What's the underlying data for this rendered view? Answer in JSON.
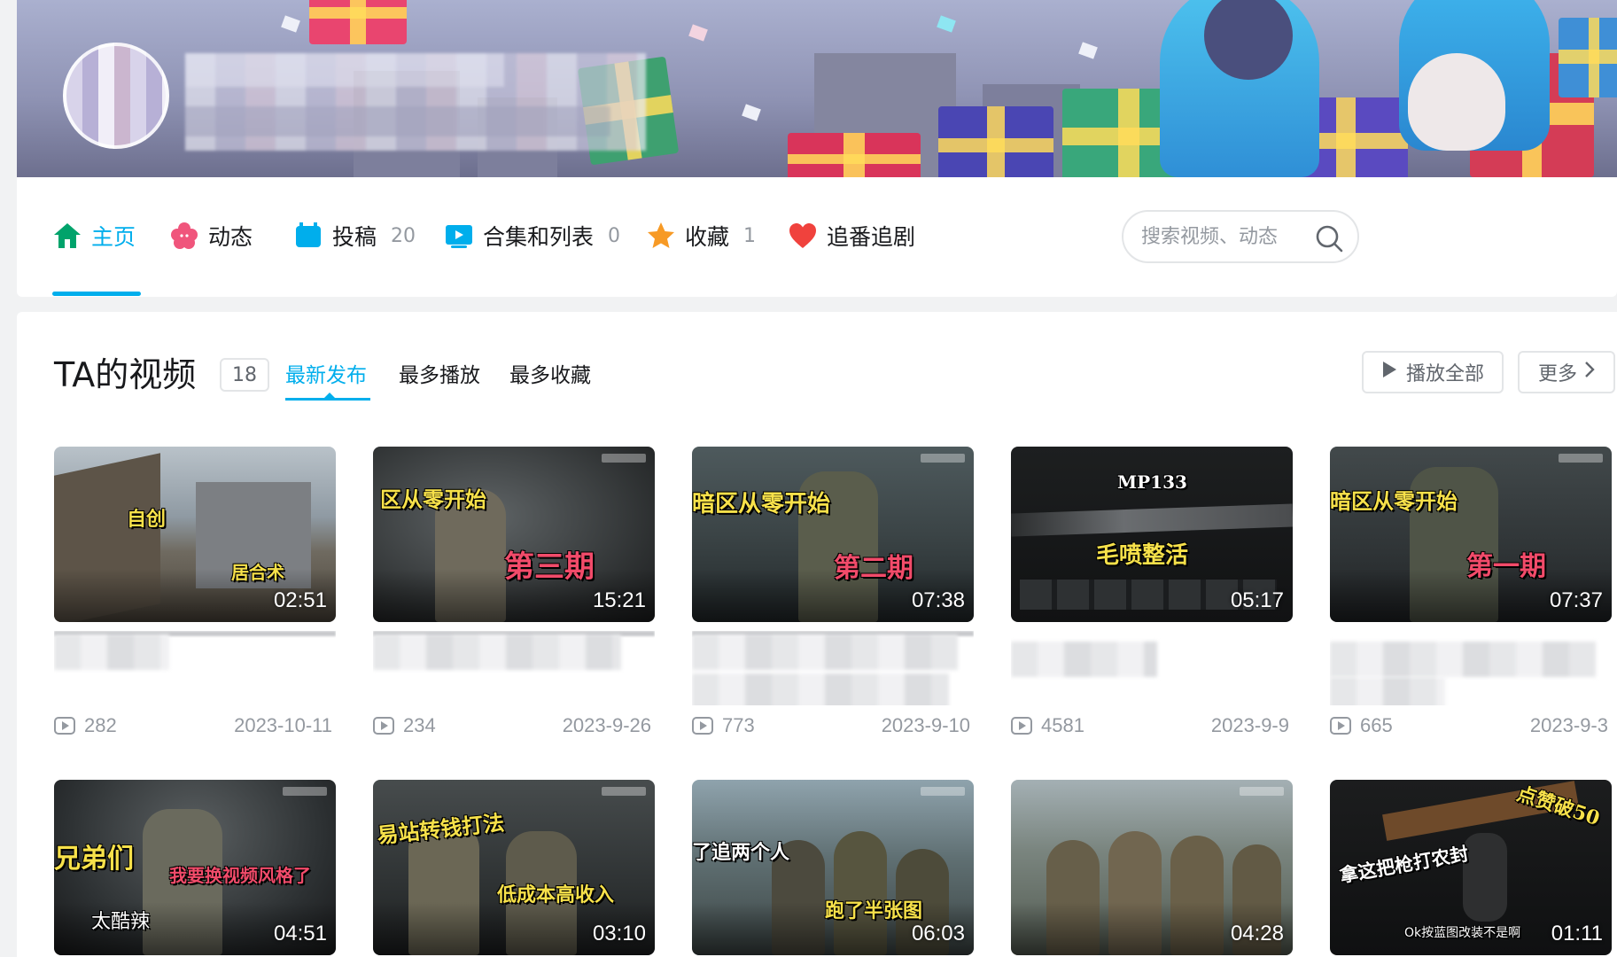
{
  "nav": {
    "tabs": [
      {
        "label": "主页",
        "count": "",
        "icon": "home-icon",
        "color": "#00a36b",
        "active": true
      },
      {
        "label": "动态",
        "count": "",
        "icon": "flower-icon",
        "color": "#f0557c"
      },
      {
        "label": "投稿",
        "count": "20",
        "icon": "video-upload-icon",
        "color": "#00aeec"
      },
      {
        "label": "合集和列表",
        "count": "0",
        "icon": "collection-icon",
        "color": "#00aeec"
      },
      {
        "label": "收藏",
        "count": "1",
        "icon": "star-icon",
        "color": "#f79a25"
      },
      {
        "label": "追番追剧",
        "count": "",
        "icon": "heart-icon",
        "color": "#f0423d"
      }
    ],
    "search_placeholder": "搜索视频、动态"
  },
  "videos_section": {
    "title": "TA的视频",
    "count": "18",
    "sort_options": [
      "最新发布",
      "最多播放",
      "最多收藏"
    ],
    "play_all_label": "播放全部",
    "more_label": "更多"
  },
  "videos": [
    {
      "duration": "02:51",
      "plays": "282",
      "date": "2023-10-11",
      "overlay": [
        "自创",
        "居合术"
      ]
    },
    {
      "duration": "15:21",
      "plays": "234",
      "date": "2023-9-26",
      "overlay": [
        "区从零开始",
        "第三期"
      ]
    },
    {
      "duration": "07:38",
      "plays": "773",
      "date": "2023-9-10",
      "overlay": [
        "暗区从零开始",
        "第二期"
      ]
    },
    {
      "duration": "05:17",
      "plays": "4581",
      "date": "2023-9-9",
      "overlay": [
        "MP133",
        "毛喷整活"
      ]
    },
    {
      "duration": "07:37",
      "plays": "665",
      "date": "2023-9-3",
      "overlay": [
        "暗区从零开始",
        "第一期"
      ]
    },
    {
      "duration": "04:51",
      "overlay": [
        "兄弟们",
        "我要换视频风格了",
        "太酷辣"
      ]
    },
    {
      "duration": "03:10",
      "overlay": [
        "易站转钱打法",
        "低成本高收入"
      ]
    },
    {
      "duration": "06:03",
      "overlay": [
        "了追两个人",
        "跑了半张图"
      ]
    },
    {
      "duration": "04:28",
      "overlay": []
    },
    {
      "duration": "01:11",
      "overlay": [
        "点赞破50",
        "拿这把枪打农封",
        "Ok按蓝图改装不是啊"
      ]
    }
  ],
  "colors": {
    "accent": "#00aeec",
    "text_primary": "#18191c",
    "text_secondary": "#9499a0",
    "background": "#f1f2f3"
  }
}
